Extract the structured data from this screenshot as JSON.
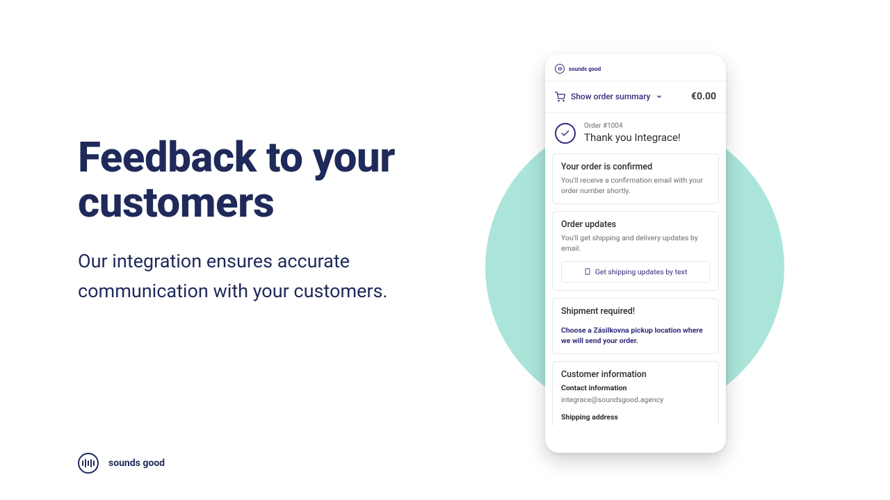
{
  "hero": {
    "headline": "Feedback to your customers",
    "subheadline": "Our integration ensures accurate communication with your customers."
  },
  "brand": {
    "name": "sounds good",
    "color": "#1f2a5a",
    "accent": "#2f2b7a",
    "circle_color": "#8fdccd"
  },
  "phone": {
    "header_brand": "sounds good",
    "summary": {
      "label": "Show order summary",
      "price": "€0.00"
    },
    "order": {
      "number": "Order #1004",
      "thank_you": "Thank you Integrace!"
    },
    "confirmed": {
      "title": "Your order is confirmed",
      "body": "You'll receive a confirmation email with your order number shortly."
    },
    "updates": {
      "title": "Order updates",
      "body": "You'll get shipping and delivery updates by email.",
      "button": "Get shipping updates by text"
    },
    "shipment": {
      "title": "Shipment required!",
      "body": "Choose a Zásilkovna pickup location where we will send your order."
    },
    "customer": {
      "title": "Customer information",
      "contact_label": "Contact information",
      "contact_value": "integrace@soundsgood.agency",
      "shipping_label": "Shipping address"
    }
  }
}
